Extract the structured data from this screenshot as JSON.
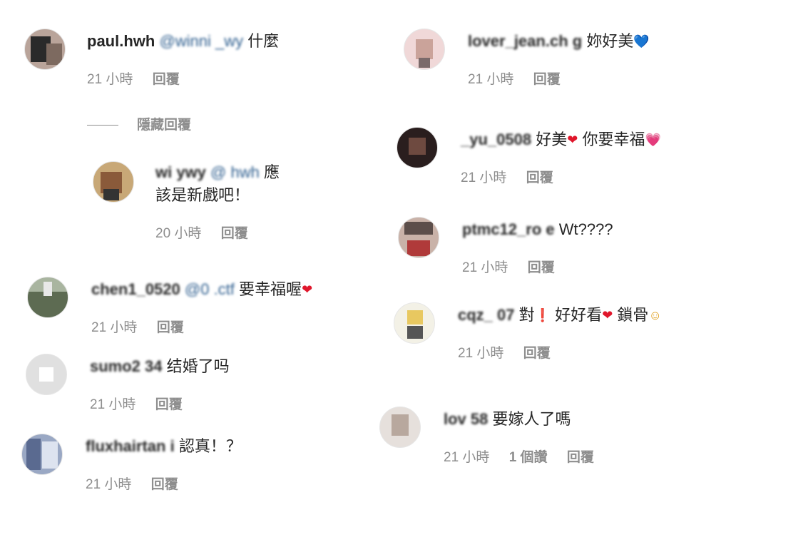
{
  "comments_left": [
    {
      "avatar": "avatar-man-dark",
      "username": "paul.hwh",
      "mention": "@winni   _wy",
      "text": "什麼",
      "time": "21 小時",
      "reply": "回覆"
    },
    {
      "avatar": "avatar-woman-blonde",
      "username": "wi      ywy",
      "mention": "@  hwh",
      "text": "應",
      "text2": "該是新戲吧！",
      "time": "20 小時",
      "reply": "回覆"
    },
    {
      "avatar": "avatar-outdoor",
      "username": "chen1_0520",
      "mention": "@0   .ctf",
      "text": "要幸福喔",
      "emoji": "❤",
      "time": "21 小時",
      "reply": "回覆"
    },
    {
      "avatar": "avatar-default",
      "username": "sumo2     34",
      "text": "结婚了吗",
      "time": "21 小時",
      "reply": "回覆"
    },
    {
      "avatar": "avatar-group",
      "username": "fluxhairtan    i",
      "text": "認真！？",
      "time": "21 小時",
      "reply": "回覆"
    }
  ],
  "hide_replies": "隱藏回覆",
  "comments_right": [
    {
      "avatar": "avatar-pink",
      "username": "lover_jean.ch    g",
      "text": "妳好美",
      "emoji": "💙",
      "time": "21 小時",
      "reply": "回覆"
    },
    {
      "avatar": "avatar-dark-hair",
      "username": "_yu_0508",
      "text": "好美",
      "emoji": "❤",
      "text2": "你要幸福",
      "emoji2": "💗",
      "time": "21 小時",
      "reply": "回覆"
    },
    {
      "avatar": "avatar-face-red",
      "username": "ptmc12_ro   e",
      "text": "Wt????",
      "time": "21 小時",
      "reply": "回覆"
    },
    {
      "avatar": "avatar-cartoon",
      "username": "cqz_  07",
      "text": "對",
      "emoji": "❗",
      "text2": "好好看",
      "emoji2": "❤",
      "text3": "鎖骨",
      "emoji3": "☺",
      "time": "21 小時",
      "reply": "回覆"
    },
    {
      "avatar": "avatar-blurry",
      "username": "lov     58",
      "text": "要嫁人了嗎",
      "time": "21 小時",
      "likes": "1 個讚",
      "reply": "回覆"
    }
  ]
}
